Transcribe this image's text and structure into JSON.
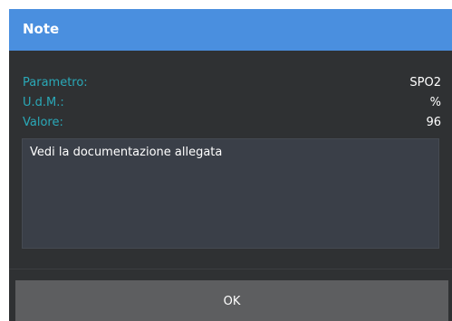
{
  "dialog": {
    "title": "Note",
    "fields": [
      {
        "label": "Parametro:",
        "value": "SPO2"
      },
      {
        "label": "U.d.M.:",
        "value": "%"
      },
      {
        "label": "Valore:",
        "value": "96"
      }
    ],
    "note_text": "Vedi la documentazione allegata",
    "ok_label": "OK"
  },
  "colors": {
    "titlebar": "#4a8fdf",
    "background": "#2f3133",
    "label": "#2aa9b8",
    "button": "#5d5e60"
  }
}
